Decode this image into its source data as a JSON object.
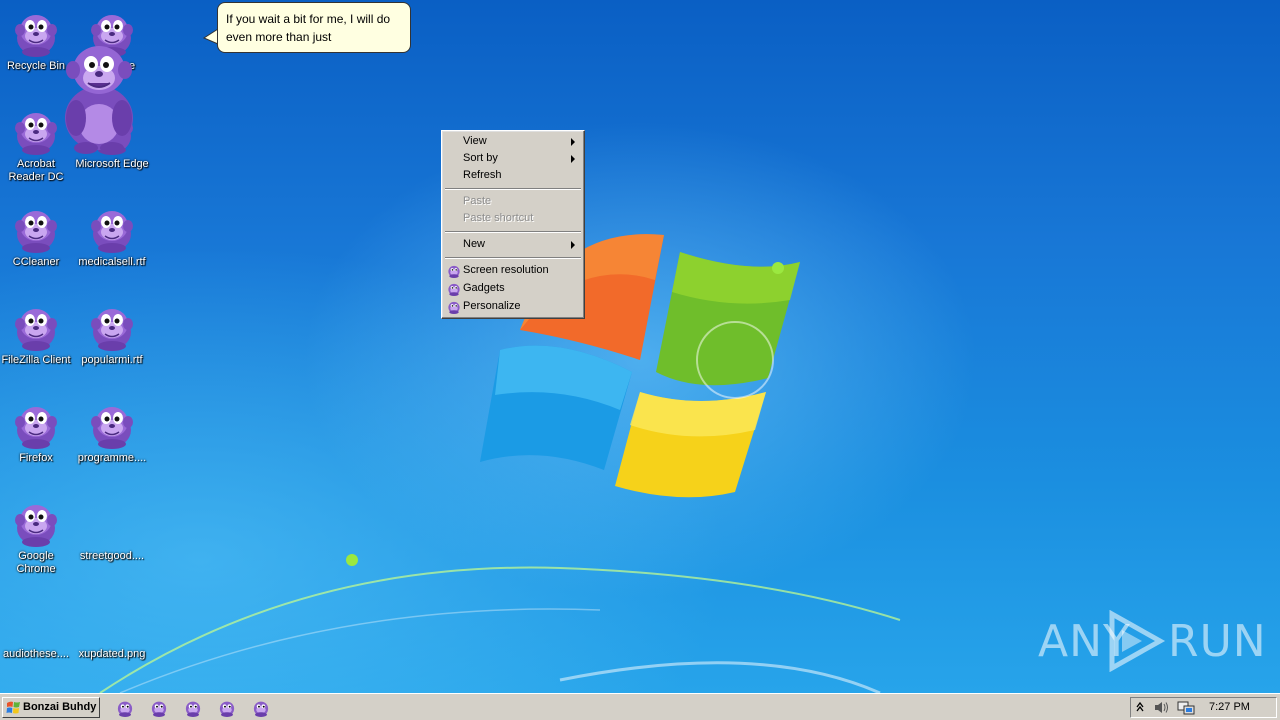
{
  "desktop": {
    "icons": [
      {
        "label": "Recycle Bin"
      },
      {
        "label": "Acrobat Reader DC"
      },
      {
        "label": "CCleaner"
      },
      {
        "label": "FileZilla Client"
      },
      {
        "label": "Firefox"
      },
      {
        "label": "Google Chrome"
      },
      {
        "label": "audiothese...."
      },
      {
        "label": "e"
      },
      {
        "label": "Microsoft Edge"
      },
      {
        "label": "medicalsell.rtf"
      },
      {
        "label": "popularmi.rtf"
      },
      {
        "label": "programme...."
      },
      {
        "label": "streetgood...."
      },
      {
        "label": "xupdated.png"
      }
    ]
  },
  "balloon": {
    "text": "If you wait a bit for me, I will do even more than just"
  },
  "context_menu": {
    "items": [
      {
        "label": "View",
        "submenu": true,
        "disabled": false
      },
      {
        "label": "Sort by",
        "submenu": true,
        "disabled": false
      },
      {
        "label": "Refresh",
        "submenu": false,
        "disabled": false
      },
      {
        "label": "Paste",
        "submenu": false,
        "disabled": true
      },
      {
        "label": "Paste shortcut",
        "submenu": false,
        "disabled": true
      },
      {
        "label": "New",
        "submenu": true,
        "disabled": false
      },
      {
        "label": "Screen resolution",
        "icon": "bonzi-icon"
      },
      {
        "label": "Gadgets",
        "icon": "bonzi-icon"
      },
      {
        "label": "Personalize",
        "icon": "bonzi-icon"
      }
    ]
  },
  "watermark": {
    "left": "ANY",
    "right": "RUN"
  },
  "taskbar": {
    "start_label": "Bonzai Buhdy",
    "quick_launch": [
      "bonzi-icon",
      "bonzi-icon",
      "bonzi-icon",
      "bonzi-icon",
      "bonzi-icon"
    ],
    "tray_icons": [
      "show-hidden-icons-icon",
      "speaker-icon",
      "network-icon"
    ],
    "clock": "7:27 PM"
  },
  "colors": {
    "bonzi_purple": "#8a5cc7",
    "menu_bg": "#d4d0c8",
    "balloon_bg": "#ffffe1"
  }
}
